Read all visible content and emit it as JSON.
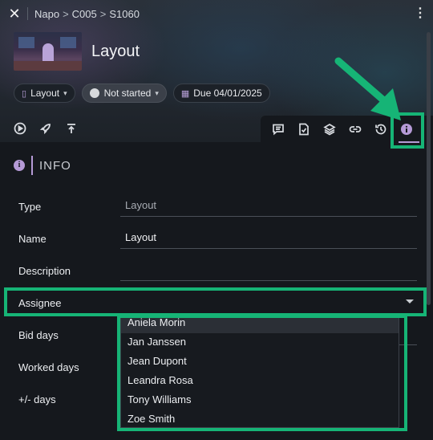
{
  "breadcrumb": [
    "Napo",
    "C005",
    "S1060"
  ],
  "task": {
    "title": "Layout"
  },
  "chips": {
    "type_label": "Layout",
    "status_label": "Not started",
    "due_label": "Due 04/01/2025"
  },
  "colors": {
    "accent": "#b59ad6",
    "highlight": "#16b476",
    "background": "#15181d"
  },
  "left_tools": [
    "play-icon",
    "rocket-icon",
    "publish-icon"
  ],
  "tabs": [
    "comments-icon",
    "checklist-icon",
    "layers-icon",
    "link-icon",
    "history-icon",
    "info-icon"
  ],
  "info": {
    "section_title": "INFO",
    "fields": [
      {
        "label": "Type",
        "value": "Layout"
      },
      {
        "label": "Name",
        "value": "Layout"
      },
      {
        "label": "Description",
        "value": ""
      },
      {
        "label": "Assignee",
        "value": ""
      },
      {
        "label": "Bid days",
        "value": ""
      },
      {
        "label": "Worked days",
        "value": ""
      },
      {
        "label": "+/- days",
        "value": ""
      }
    ]
  },
  "assignee_options": [
    "Aniela Morin",
    "Jan Janssen",
    "Jean Dupont",
    "Leandra Rosa",
    "Tony Williams",
    "Zoe Smith"
  ]
}
